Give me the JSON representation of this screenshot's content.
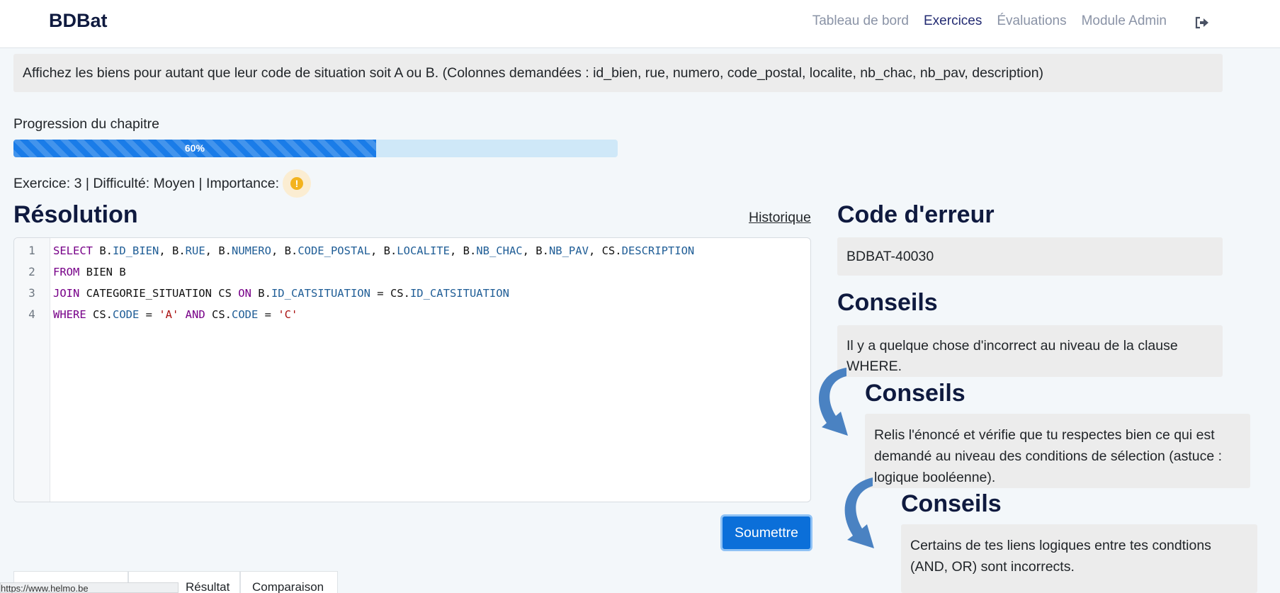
{
  "navbar": {
    "brand": "BDBat",
    "links": [
      {
        "label": "Tableau de bord",
        "active": false
      },
      {
        "label": "Exercices",
        "active": true
      },
      {
        "label": "Évaluations",
        "active": false
      },
      {
        "label": "Module Admin",
        "active": false
      }
    ],
    "logout_icon": "sign-out-icon"
  },
  "statement": "Affichez les biens pour autant que leur code de situation soit A ou B. (Colonnes demandées : id_bien, rue, numero, code_postal, localite, nb_chac, nb_pav, description)",
  "progress": {
    "label": "Progression du chapitre",
    "percent": 60,
    "text": "60%"
  },
  "meta": {
    "text": "Exercice: 3 | Difficulté: Moyen | Importance:",
    "importance_icon": "exclamation-icon",
    "importance_color": "#f3b31e"
  },
  "resolution": {
    "title": "Résolution",
    "history_link": "Historique",
    "line_numbers": [
      "1",
      "2",
      "3",
      "4"
    ],
    "submit_label": "Soumettre"
  },
  "tabs": [
    "",
    "Résultat obtenu",
    "Comparaison"
  ],
  "status_url": "https://www.helmo.be",
  "right_panel": {
    "error_title": "Code d'erreur",
    "error_code": "BDBAT-40030",
    "tips": [
      {
        "title": "Conseils",
        "text": "Il y a quelque chose d'incorrect au niveau de la clause WHERE."
      },
      {
        "title": "Conseils",
        "text": "Relis l'énoncé et vérifie que tu respectes bien ce qui est demandé au niveau des conditions de sélection (astuce : logique booléenne)."
      },
      {
        "title": "Conseils",
        "text": "Certains de tes liens logiques entre tes condtions (AND, OR) sont incorrects."
      }
    ]
  },
  "colors": {
    "brand": "#0f1a3f",
    "nav_active": "#232b72",
    "primary": "#0b6fd9",
    "progress": "#1a7ce8"
  }
}
